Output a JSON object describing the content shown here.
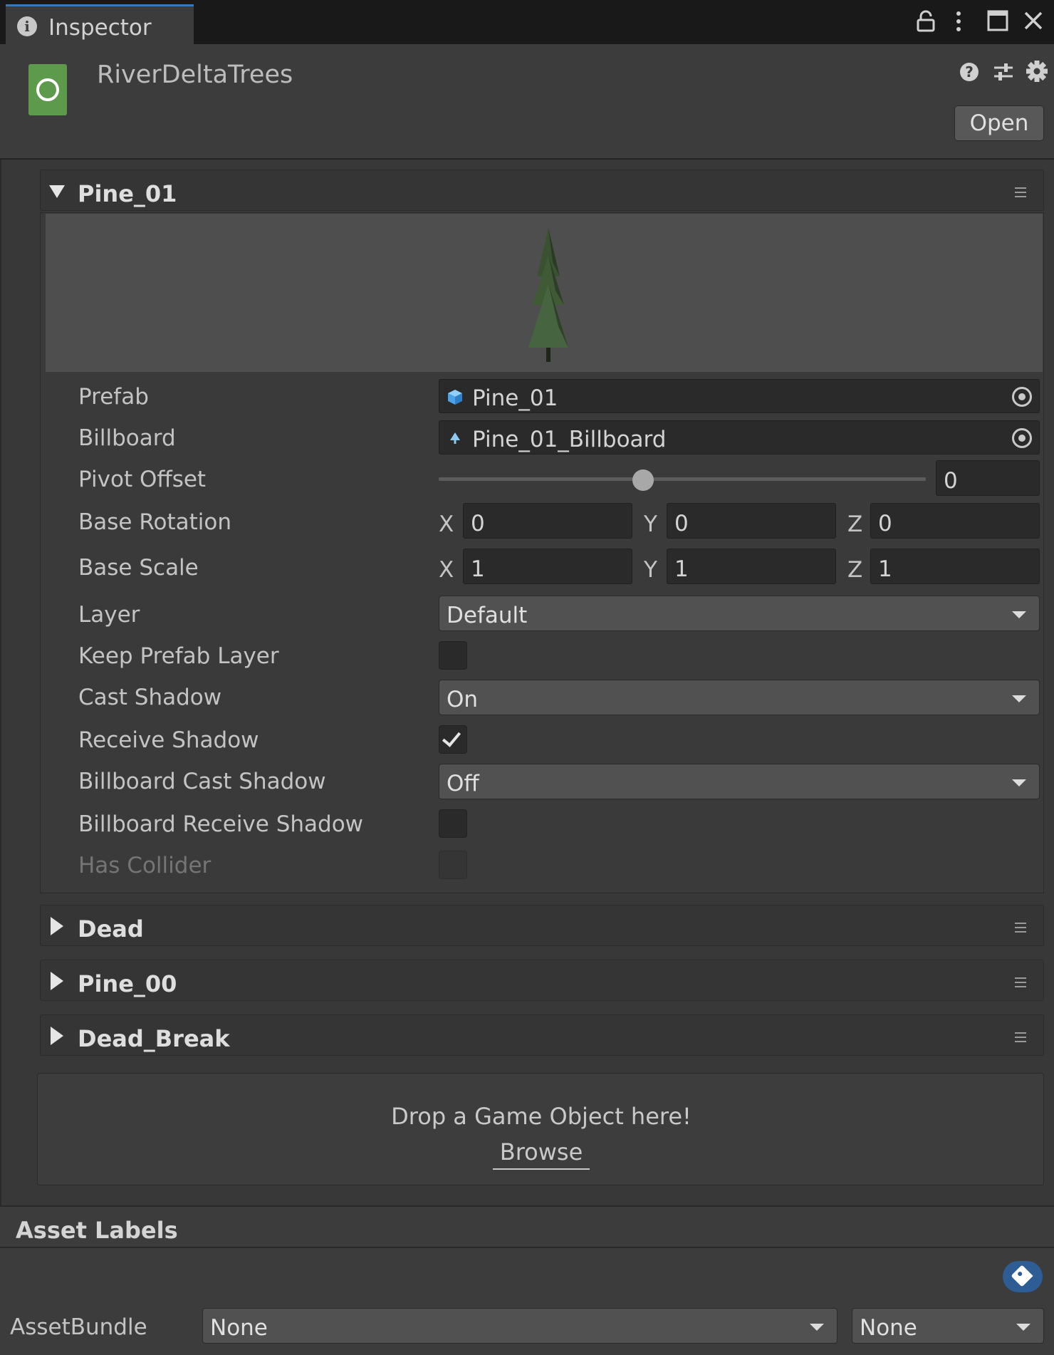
{
  "tab": {
    "label": "Inspector",
    "icon": "info-icon"
  },
  "window_controls": [
    "lock-icon",
    "kebab-menu-icon",
    "maximize-icon",
    "close-icon"
  ],
  "header": {
    "asset_name": "RiverDeltaTrees",
    "icons": [
      "help-icon",
      "presets-icon",
      "settings-icon"
    ],
    "open_label": "Open"
  },
  "sections": [
    {
      "title": "Pine_01",
      "expanded": true
    },
    {
      "title": "Dead",
      "expanded": false
    },
    {
      "title": "Pine_00",
      "expanded": false
    },
    {
      "title": "Dead_Break",
      "expanded": false
    }
  ],
  "pine_01": {
    "prefab": {
      "label": "Prefab",
      "value": "Pine_01"
    },
    "billboard": {
      "label": "Billboard",
      "value": "Pine_01_Billboard"
    },
    "pivot_offset": {
      "label": "Pivot Offset",
      "value": "0",
      "slider_fraction": 0.42
    },
    "base_rotation": {
      "label": "Base Rotation",
      "x": "0",
      "y": "0",
      "z": "0"
    },
    "base_scale": {
      "label": "Base Scale",
      "x": "1",
      "y": "1",
      "z": "1"
    },
    "axis_labels": {
      "x": "X",
      "y": "Y",
      "z": "Z"
    },
    "layer": {
      "label": "Layer",
      "value": "Default"
    },
    "keep_prefab_layer": {
      "label": "Keep Prefab Layer",
      "checked": false
    },
    "cast_shadow": {
      "label": "Cast Shadow",
      "value": "On"
    },
    "receive_shadow": {
      "label": "Receive Shadow",
      "checked": true
    },
    "billboard_cast_shadow": {
      "label": "Billboard Cast Shadow",
      "value": "Off"
    },
    "billboard_receive_shadow": {
      "label": "Billboard Receive Shadow",
      "checked": false
    },
    "has_collider": {
      "label": "Has Collider",
      "checked": false,
      "disabled": true
    }
  },
  "drop_area": {
    "text": "Drop a Game Object here!",
    "browse": "Browse"
  },
  "asset_labels": {
    "title": "Asset Labels",
    "assetbundle_label": "AssetBundle",
    "bundle_name": "None",
    "bundle_variant": "None"
  },
  "colors": {
    "accent": "#3a79bb",
    "tree_green": "#3f5a35",
    "tag_blue": "#2e5c95"
  }
}
